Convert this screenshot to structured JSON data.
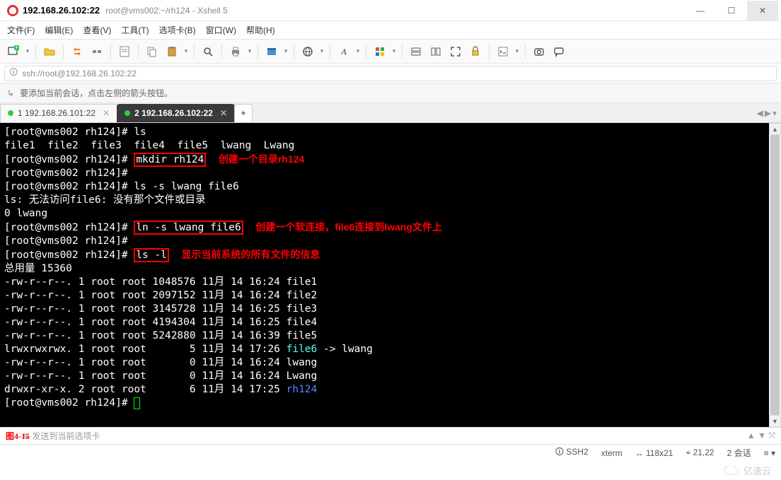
{
  "title": {
    "ip": "192.168.26.102:22",
    "sub": "root@vms002:~/rh124 - Xshell 5"
  },
  "menu": {
    "file": "文件(F)",
    "edit": "编辑(E)",
    "view": "查看(V)",
    "tools": "工具(T)",
    "tabs": "选项卡(B)",
    "window": "窗口(W)",
    "help": "帮助(H)"
  },
  "address": {
    "url": "ssh://root@192.168.26.102:22"
  },
  "hint": {
    "text": "要添加当前会话，点击左侧的箭头按钮。"
  },
  "tabs": {
    "t1": {
      "label": "1 192.168.26.101:22"
    },
    "t2": {
      "label": "2 192.168.26.102:22"
    },
    "add": "+"
  },
  "term": {
    "l1_prompt": "[root@vms002 rh124]# ",
    "l1_cmd": "ls",
    "l2": "file1  file2  file3  file4  file5  lwang  Lwang",
    "l3_prompt": "[root@vms002 rh124]# ",
    "l3_cmd": "mkdir rh124",
    "l3_note": "创建一个目录rh124",
    "l4": "[root@vms002 rh124]#",
    "l5_prompt": "[root@vms002 rh124]# ",
    "l5_cmd": "ls -s lwang file6",
    "l6": "ls: 无法访问file6: 没有那个文件或目录",
    "l7": "0 lwang",
    "l8_prompt": "[root@vms002 rh124]# ",
    "l8_cmd": "ln -s lwang file6",
    "l8_note": "创建一个软连接，file6连接到lwang文件上",
    "l9": "[root@vms002 rh124]#",
    "l10_prompt": "[root@vms002 rh124]# ",
    "l10_cmd": "ls -l",
    "l10_note": "显示当前系统的所有文件的信息",
    "l11": "总用量 15360",
    "l12": "-rw-r--r--. 1 root root 1048576 11月 14 16:24 file1",
    "l13": "-rw-r--r--. 1 root root 2097152 11月 14 16:24 file2",
    "l14": "-rw-r--r--. 1 root root 3145728 11月 14 16:25 file3",
    "l15": "-rw-r--r--. 1 root root 4194304 11月 14 16:25 file4",
    "l16": "-rw-r--r--. 1 root root 5242880 11月 14 16:39 file5",
    "l17a": "lrwxrwxrwx. 1 root root       5 11月 14 17:26 ",
    "l17b": "file6",
    "l17c": " -> lwang",
    "l18": "-rw-r--r--. 1 root root       0 11月 14 16:24 lwang",
    "l19": "-rw-r--r--. 1 root root       0 11月 14 16:24 Lwang",
    "l20a": "drwxr-xr-x. 2 root root       6 11月 14 17:25 ",
    "l20b": "rh124",
    "l21": "[root@vms002 rh124]# "
  },
  "footer": {
    "figure": "图4-15",
    "send_hint": "发送到当前选项卡"
  },
  "status": {
    "proto": "SSH2",
    "term": "xterm",
    "size": "118x21",
    "pos": "21,22",
    "sessions": "2 会话"
  },
  "watermark": "亿速云",
  "icons": {
    "minimize": "—",
    "maximize": "☐",
    "close": "✕",
    "plus": "＋",
    "chev": "▾",
    "left": "◀",
    "right": "▶",
    "up": "▲",
    "down": "▼",
    "pin": "⤧",
    "dots": "⋯",
    "lock": "🛈",
    "arrow_hint": "↳",
    "resize": "⇲"
  }
}
